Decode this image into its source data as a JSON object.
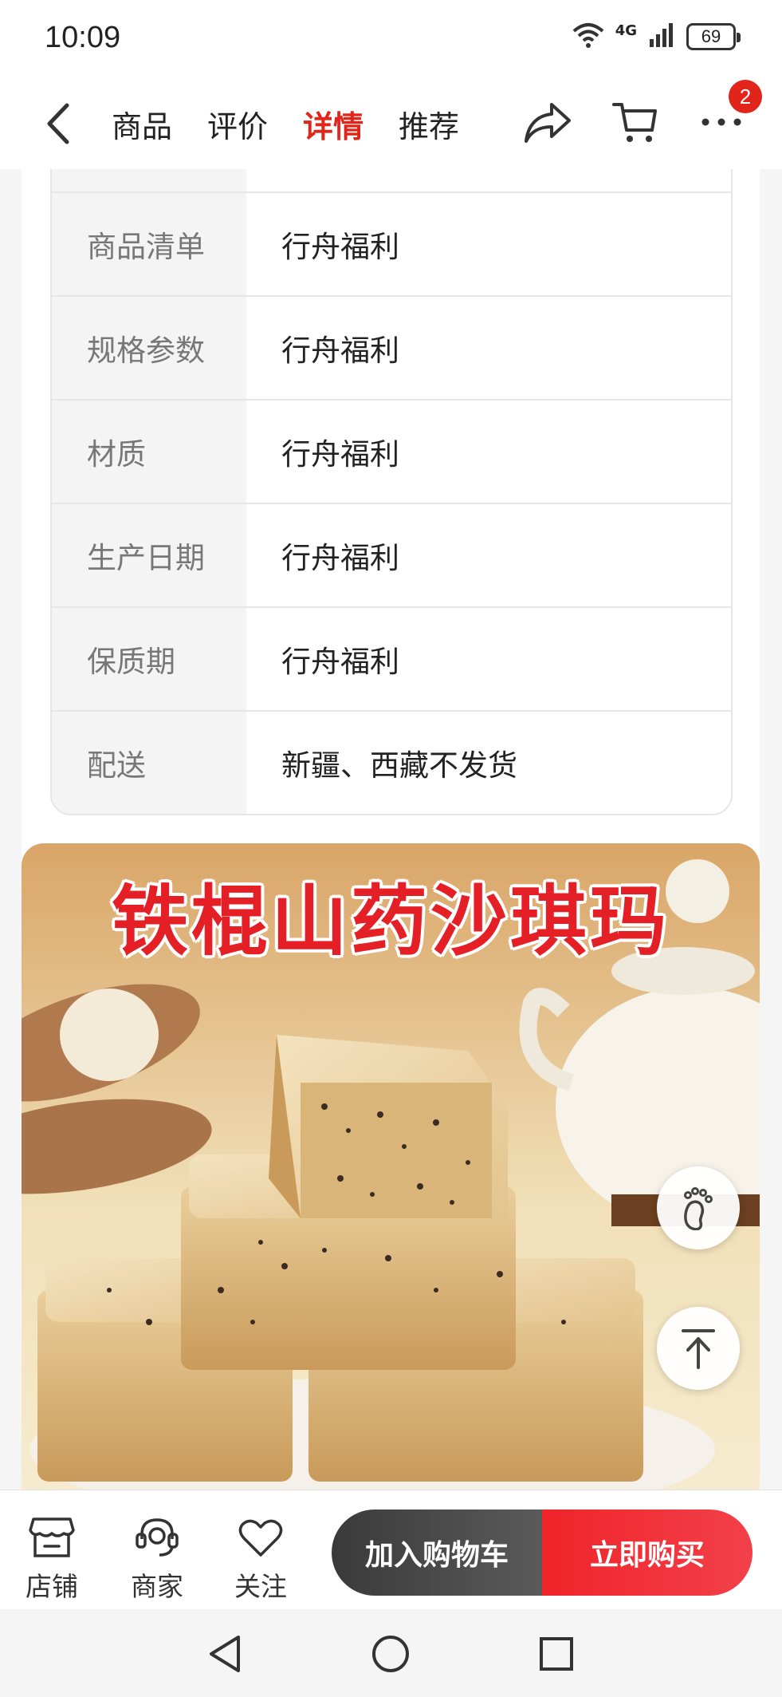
{
  "status_bar": {
    "time": "10:09",
    "network": "4G",
    "battery": "69"
  },
  "nav": {
    "tabs": [
      {
        "label": "商品",
        "active": false
      },
      {
        "label": "评价",
        "active": false
      },
      {
        "label": "详情",
        "active": true
      },
      {
        "label": "推荐",
        "active": false
      }
    ],
    "more_badge": "2",
    "icons": [
      "back-arrow-icon",
      "share-icon",
      "cart-icon",
      "more-dots-icon"
    ]
  },
  "specs": [
    {
      "label": "商品清单",
      "value": "行舟福利"
    },
    {
      "label": "规格参数",
      "value": "行舟福利"
    },
    {
      "label": "材质",
      "value": "行舟福利"
    },
    {
      "label": "生产日期",
      "value": "行舟福利"
    },
    {
      "label": "保质期",
      "value": "行舟福利"
    },
    {
      "label": "配送",
      "value": "新疆、西藏不发货"
    }
  ],
  "product_image": {
    "title": "铁棍山药沙琪玛"
  },
  "bottom_bar": {
    "store_label": "店铺",
    "merchant_label": "商家",
    "follow_label": "关注",
    "add_to_cart_label": "加入购物车",
    "buy_now_label": "立即购买"
  },
  "colors": {
    "accent": "#e1251b",
    "dark_button": "#3a3a3a"
  }
}
